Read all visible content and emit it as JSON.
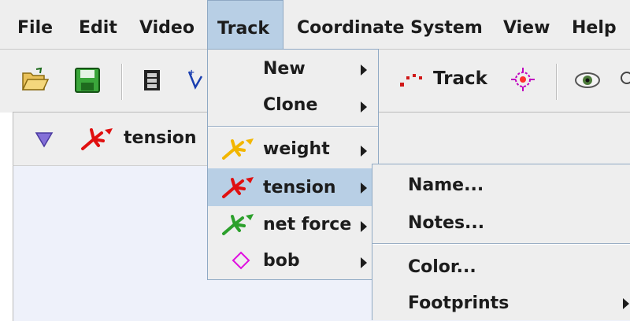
{
  "menubar": {
    "file": "File",
    "edit": "Edit",
    "video": "Video",
    "track": "Track",
    "coordinate_system": "Coordinate System",
    "view": "View",
    "help": "Help"
  },
  "toolbar": {
    "track_label": "Track"
  },
  "tabbar": {
    "selected_track": "tension"
  },
  "track_menu": {
    "new": "New",
    "clone": "Clone",
    "weight": "weight",
    "tension": "tension",
    "net_force": "net force",
    "bob": "bob"
  },
  "submenu": {
    "name": "Name...",
    "notes": "Notes...",
    "color": "Color...",
    "footprints": "Footprints"
  },
  "colors": {
    "highlight": "#b8cfe5",
    "weight": "#f2b600",
    "tension": "#e01010",
    "net_force": "#2ca02c",
    "bob": "#e010e0"
  }
}
